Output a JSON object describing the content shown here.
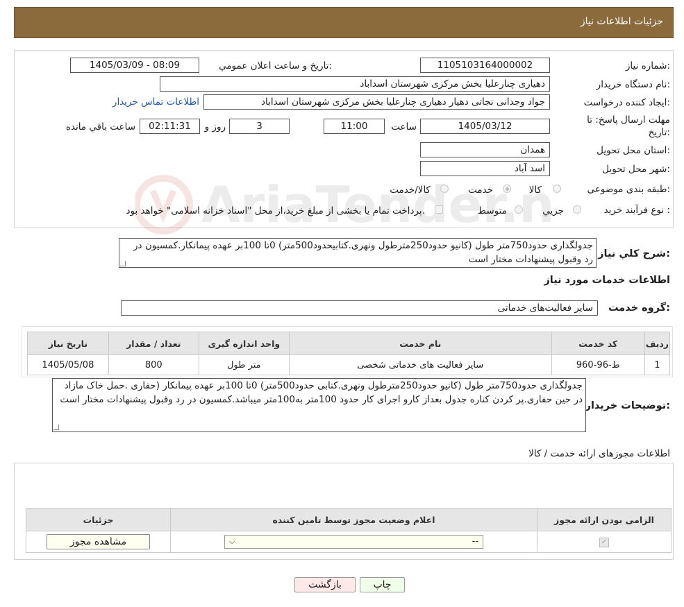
{
  "header": {
    "title": "جزئیات اطلاعات نیاز"
  },
  "form": {
    "need_number_label": "شماره نیاز:",
    "need_number": "1105103164000002",
    "announce_label": "تاریخ و ساعت اعلان عمومي:",
    "announce_value": "1405/03/09 - 08:09",
    "buyer_label": "نام دستگاه خریدار:",
    "buyer_value": "دهیاری چنارعلیا بخش مرکزی شهرستان اسداباد",
    "requester_label": "ایجاد کننده درخواست:",
    "requester_value": "جواد وجدانی نجاتی دهیار دهیاری چنارعلیا بخش مرکزی شهرستان اسداباد",
    "contact_link": "اطلاعات تماس خریدار",
    "deadline_label_1": "مهلت ارسال پاسخ: تا",
    "deadline_label_2": "تاریخ:",
    "deadline_date": "1405/03/12",
    "time_label": "ساعت",
    "deadline_time": "11:00",
    "days_value": "3",
    "days_label": "روز و",
    "remaining_time": "02:11:31",
    "remaining_label": "ساعت باقي مانده",
    "province_label": "استان محل تحویل:",
    "province_value": "همدان",
    "city_label": "شهر محل تحویل:",
    "city_value": "اسد آباد",
    "category_label": "طبقه بندی موضوعی:",
    "category_options": [
      "کالا",
      "خدمت",
      "کالا/خدمت"
    ],
    "category_selected": "خدمت",
    "process_label": "نوع فرآیند خرید :",
    "process_options": [
      "جزیي",
      "متوسط"
    ],
    "process_note": "پرداخت تمام یا بخشی از مبلغ خرید،از محل \"اسناد خزانه اسلامی\" خواهد بود.",
    "summary_label": "شرح کلي نیاز:",
    "summary_text": "جدولگذاری حدود750متر طول (کانیو حدود250مترطول ونهری.کتابیحدود500متر) 0تا 100بر عهده پیمانکار.کمسیون در رد وقبول پیشنهادات مختار است"
  },
  "services": {
    "section_title": "اطلاعات خدمات مورد نیاز",
    "group_label": "گروه خدمت:",
    "group_value": "سایر فعالیت‌های خدماتی",
    "table": {
      "headers": [
        "ردیف",
        "کد خدمت",
        "نام خدمت",
        "واحد اندازه گیری",
        "تعداد / مقدار",
        "تاریخ نیاز"
      ],
      "rows": [
        [
          "1",
          "ط-96-960",
          "سایر فعالیت های خدماتی شخصی",
          "متر طول",
          "800",
          "1405/05/08"
        ]
      ]
    },
    "buyer_notes_label": "توضیحات خریدار:",
    "buyer_notes": "جدولگذاری حدود750متر طول (کانیو حدود250مترطول ونهری.کتابی حدود500متر) 0تا 100بر عهده پیمانکار (حفاری .حمل خاک مازاد در حین حفاری.پر کردن کناره جدول بعداز کارو اجرای کار حدود 100متر به100متر میباشد.کمسیون در رد وقبول پیشنهادات مختار است"
  },
  "permits": {
    "section_title": "اطلاعات مجوزهای ارائه خدمت / کالا",
    "headers": [
      "الزامی بودن ارائه مجوز",
      "اعلام وضعیت مجوز توسط تامین کننده",
      "جزئیات"
    ],
    "select_value": "--",
    "view_button": "مشاهده مجوز"
  },
  "footer": {
    "print_button": "چاپ",
    "back_button": "بازگشت"
  }
}
